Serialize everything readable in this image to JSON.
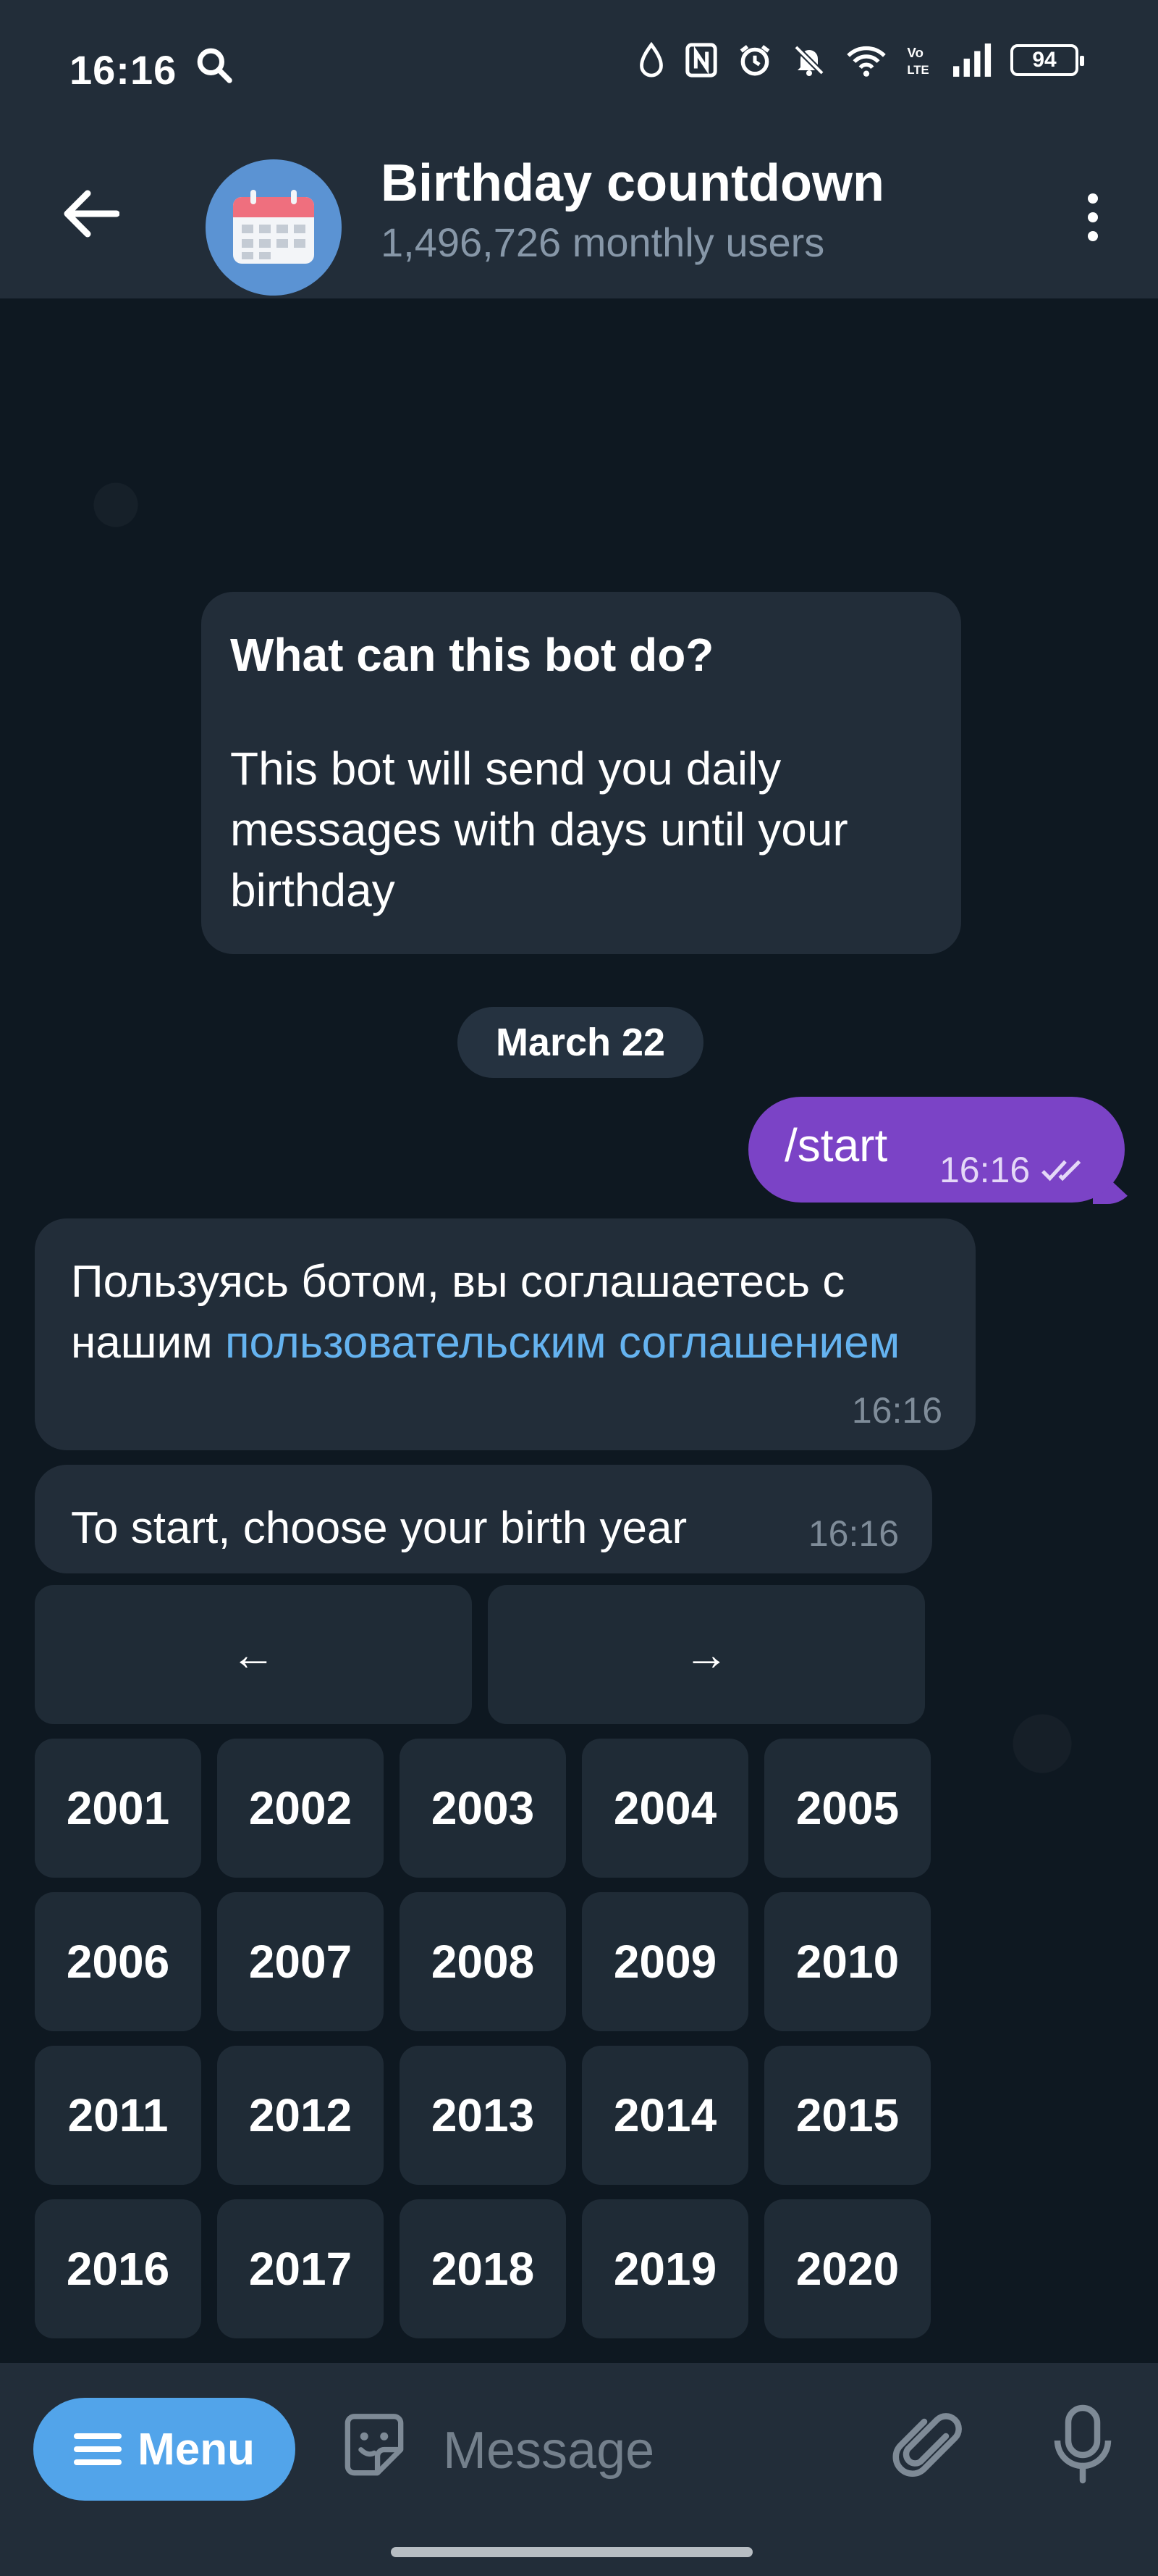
{
  "status_bar": {
    "time": "16:16",
    "battery": "94",
    "icons": [
      "search-icon",
      "drop-icon",
      "nfc-icon",
      "alarm-icon",
      "mute-icon",
      "wifi-icon",
      "volte-icon",
      "signal-icon",
      "battery-icon"
    ]
  },
  "header": {
    "title": "Birthday countdown",
    "subtitle": "1,496,726 monthly users",
    "avatar_color": "#5b93d3"
  },
  "chat": {
    "bot_info": {
      "title": "What can this bot do?",
      "description": "This bot will send you daily messages with days until your birthday"
    },
    "date_chip": "March 22",
    "outgoing": {
      "text": "/start",
      "time": "16:16",
      "read": true
    },
    "incoming_1": {
      "text_before": "Пользуясь ботом, вы соглашаетесь с нашим ",
      "link": "пользовательским соглашением",
      "time": "16:16"
    },
    "incoming_2": {
      "text": "To start, choose your birth year",
      "time": "16:16"
    },
    "keyboard": {
      "prev": "←",
      "next": "→",
      "years": [
        [
          "2001",
          "2002",
          "2003",
          "2004",
          "2005"
        ],
        [
          "2006",
          "2007",
          "2008",
          "2009",
          "2010"
        ],
        [
          "2011",
          "2012",
          "2013",
          "2014",
          "2015"
        ],
        [
          "2016",
          "2017",
          "2018",
          "2019",
          "2020"
        ]
      ]
    }
  },
  "input_bar": {
    "menu_label": "Menu",
    "placeholder": "Message"
  },
  "colors": {
    "accent": "#52a4ea",
    "outgoing_bubble": "#7b43c6",
    "incoming_bubble": "#222d39",
    "link": "#65b3f0"
  }
}
